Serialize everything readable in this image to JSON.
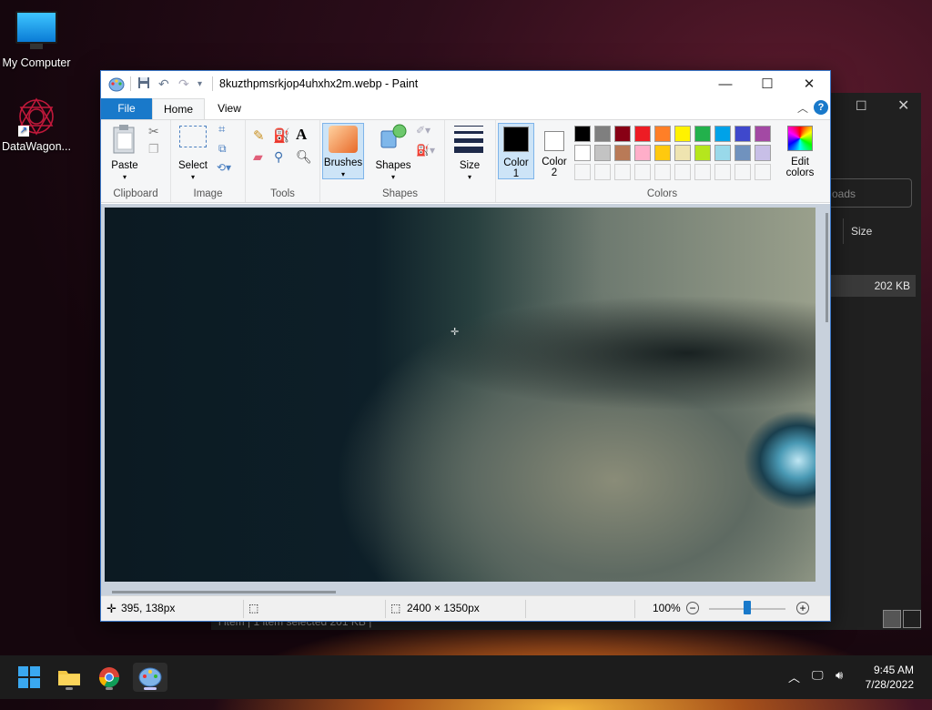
{
  "desktop": {
    "icons": [
      {
        "label": "My Computer",
        "icon": "monitor-icon"
      },
      {
        "label": "DataWagon...",
        "icon": "datawagon-icon"
      }
    ]
  },
  "explorer_bg": {
    "search_placeholder": "oads",
    "column_size": "Size",
    "row_size": "202 KB",
    "status": "l item  |  1 item selected  201 KB  |"
  },
  "paint": {
    "title": "8kuzthpmsrkjop4uhxhx2m.webp - Paint",
    "tabs": {
      "file": "File",
      "home": "Home",
      "view": "View"
    },
    "groups": {
      "clipboard": "Clipboard",
      "image": "Image",
      "tools": "Tools",
      "shapes": "Shapes",
      "colors": "Colors"
    },
    "buttons": {
      "paste": "Paste",
      "select": "Select",
      "brushes": "Brushes",
      "shapes": "Shapes",
      "size": "Size",
      "color1_line1": "Color",
      "color1_line2": "1",
      "color2_line1": "Color",
      "color2_line2": "2",
      "edit_colors_line1": "Edit",
      "edit_colors_line2": "colors"
    },
    "palette_row1": [
      "#000000",
      "#7f7f7f",
      "#880015",
      "#ed1c24",
      "#ff7f27",
      "#fff200",
      "#22b14c",
      "#00a2e8",
      "#3f48cc",
      "#a349a4"
    ],
    "palette_row2": [
      "#ffffff",
      "#c3c3c3",
      "#b97a57",
      "#ffaec9",
      "#ffc90e",
      "#efe4b0",
      "#b5e61d",
      "#99d9ea",
      "#7092be",
      "#c8bfe7"
    ],
    "color1": "#000000",
    "color2": "#ffffff",
    "status": {
      "cursor_pos": "395, 138px",
      "image_size": "2400 × 1350px",
      "zoom": "100%"
    }
  },
  "taskbar": {
    "time": "9:45 AM",
    "date": "7/28/2022"
  }
}
